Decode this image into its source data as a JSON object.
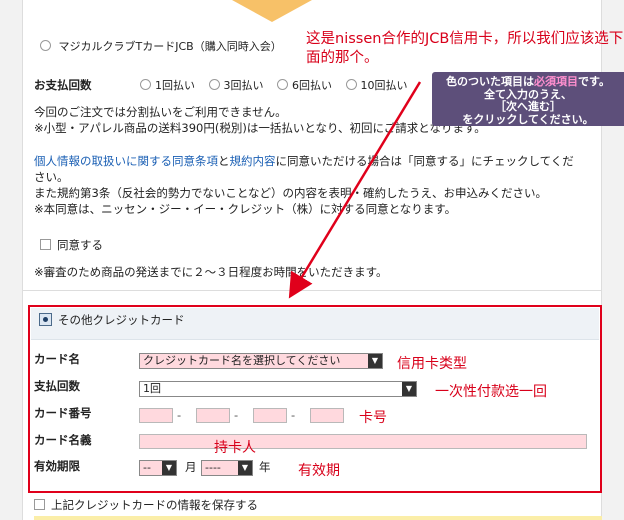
{
  "magical_card": {
    "label": "マジカルクラブTカードJCB（購入同時入会）"
  },
  "installments": {
    "label": "お支払回数",
    "options": [
      "1回払い",
      "3回払い",
      "6回払い",
      "10回払い"
    ]
  },
  "tooltip": {
    "line1_pre": "色のついた項目は",
    "line1_req": "必須項目",
    "line1_post": "です。",
    "line2": "全て入力のうえ、",
    "line3": "［次へ進む］",
    "line4": "をクリックしてください。"
  },
  "notes": {
    "line1": "今回のご注文では分割払いをご利用できません。",
    "line2": "※小型・アパレル商品の送料390円(税別)は一括払いとなり、初回にご請求となります。",
    "consent_link1": "個人情報の取扱いに関する同意条項",
    "consent_and": "と",
    "consent_link2": "規約内容",
    "consent_rest": "に同意いただける場合は「同意する」にチェックしてください。",
    "consent2": "また規約第3条（反社会的勢力でないことなど）の内容を表明・確約したうえ、お申込みください。",
    "consent3": "※本同意は、ニッセン・ジー・イー・クレジット（株）に対する同意となります。",
    "agree_label": "同意する",
    "shipping_note": "※審査のため商品の発送までに２～３日程度お時間をいただきます。"
  },
  "other_card": {
    "header": "その他クレジットカード",
    "card_name_label": "カード名",
    "card_name_value": "クレジットカード名を選択してください",
    "installment_label": "支払回数",
    "installment_value": "1回",
    "card_number_label": "カード番号",
    "number_sep": "-",
    "holder_label": "カード名義",
    "expiry_label": "有効期限",
    "expiry_month_value": "--",
    "month_suffix": "月",
    "expiry_year_value": "----",
    "year_suffix": "年",
    "save_label": "上記クレジットカードの情報を保存する"
  },
  "annotations": {
    "top": "这是nissen合作的JCB信用卡，所以我们应该选下面的那个。",
    "card_type": "信用卡类型",
    "installment": "一次性付款选一回",
    "card_number": "卡号",
    "holder": "持卡人",
    "expiry": "有效期"
  },
  "colors": {
    "annotation_red": "#e0001b",
    "tooltip_bg": "#5d4f7a",
    "required_field": "#ffd9de",
    "arrow_orange": "#f7c168"
  }
}
